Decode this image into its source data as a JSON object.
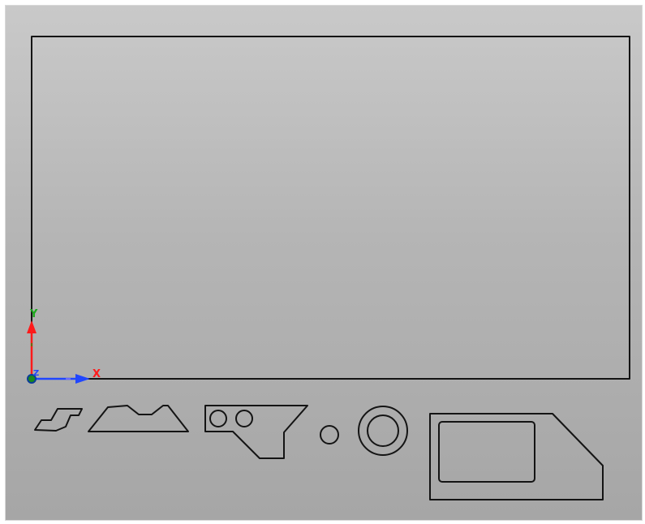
{
  "viewport": {
    "background_top": "#c9c9c9",
    "background_bottom": "#a6a6a6",
    "line_color": "#141414"
  },
  "triad": {
    "x_label": "X",
    "y_label": "Y",
    "z_label": "Z",
    "x_color": "#2046ff",
    "y_color": "#ff1a1a",
    "origin_color": "#1a8a1a"
  },
  "parts": [
    {
      "name": "s-bracket"
    },
    {
      "name": "trapezoid-notched"
    },
    {
      "name": "plate-with-two-holes"
    },
    {
      "name": "small-circle"
    },
    {
      "name": "washer"
    },
    {
      "name": "plate-with-pocket"
    }
  ]
}
